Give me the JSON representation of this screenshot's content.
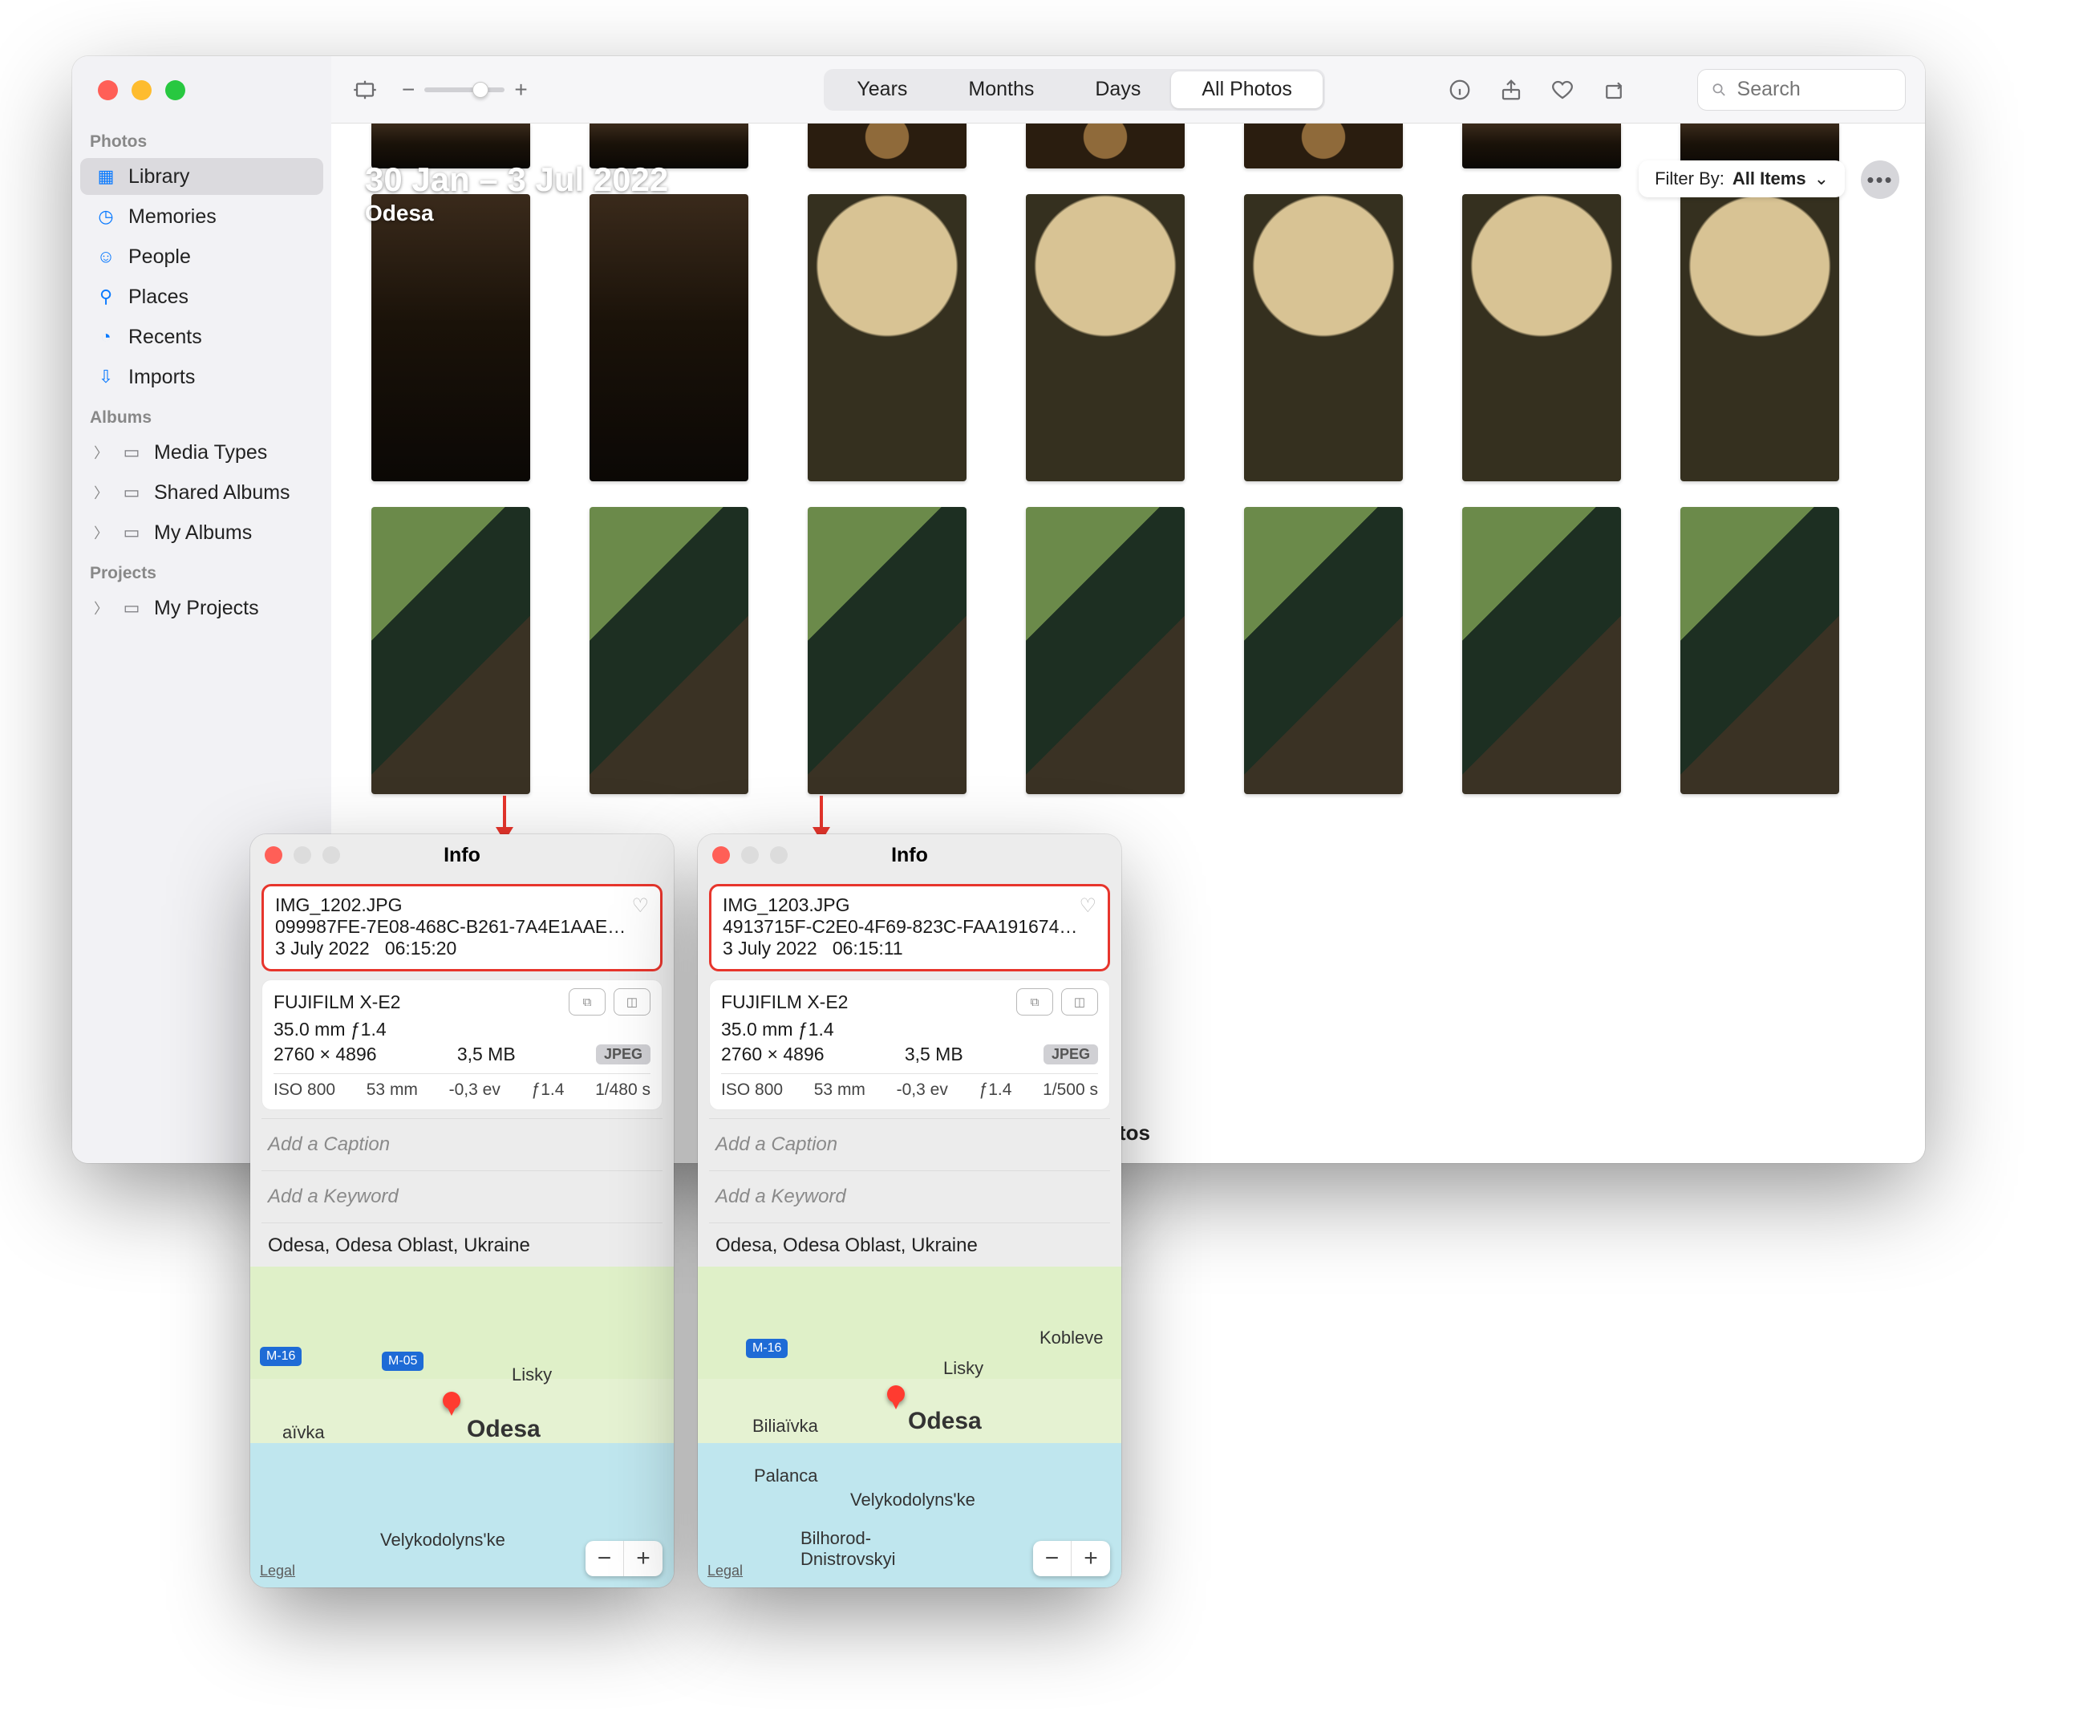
{
  "sidebar": {
    "sections": {
      "photos": "Photos",
      "albums": "Albums",
      "projects": "Projects"
    },
    "items": {
      "library": "Library",
      "memories": "Memories",
      "people": "People",
      "places": "Places",
      "recents": "Recents",
      "imports": "Imports",
      "mediaTypes": "Media Types",
      "sharedAlbums": "Shared Albums",
      "myAlbums": "My Albums",
      "myProjects": "My Projects"
    }
  },
  "toolbar": {
    "seg": {
      "years": "Years",
      "months": "Months",
      "days": "Days",
      "all": "All Photos"
    },
    "searchPlaceholder": "Search",
    "filterLabel": "Filter By:",
    "filterValue": "All Items"
  },
  "hero": {
    "title": "30 Jan – 3 Jul 2022",
    "subtitle": "Odesa"
  },
  "footer": {
    "label": "otos"
  },
  "infoWindow": {
    "title": "Info"
  },
  "panel1": {
    "filename": "IMG_1202.JPG",
    "uuid": "099987FE-7E08-468C-B261-7A4E1AAEFA...",
    "date": "3 July 2022",
    "time": "06:15:20",
    "camera": "FUJIFILM X-E2",
    "lens": "35.0 mm ƒ1.4",
    "dims": "2760 × 4896",
    "size": "3,5 MB",
    "format": "JPEG",
    "exif": {
      "iso": "ISO 800",
      "focal": "53 mm",
      "ev": "-0,3 ev",
      "ap": "ƒ1.4",
      "shutter": "1/480 s"
    },
    "caption": "Add a Caption",
    "keyword": "Add a Keyword",
    "location": "Odesa, Odesa Oblast, Ukraine",
    "legal": "Legal"
  },
  "panel2": {
    "filename": "IMG_1203.JPG",
    "uuid": "4913715F-C2E0-4F69-823C-FAA1916745B...",
    "date": "3 July 2022",
    "time": "06:15:11",
    "camera": "FUJIFILM X-E2",
    "lens": "35.0 mm ƒ1.4",
    "dims": "2760 × 4896",
    "size": "3,5 MB",
    "format": "JPEG",
    "exif": {
      "iso": "ISO 800",
      "focal": "53 mm",
      "ev": "-0,3 ev",
      "ap": "ƒ1.4",
      "shutter": "1/500 s"
    },
    "caption": "Add a Caption",
    "keyword": "Add a Keyword",
    "location": "Odesa, Odesa Oblast, Ukraine",
    "legal": "Legal"
  },
  "map": {
    "cities": {
      "odesa": "Odesa",
      "lisky": "Lisky",
      "biliaivka": "Biliaïvka",
      "velyko": "Velykodolyns'ke",
      "palanca": "Palanca",
      "kobleve": "Kobleve",
      "bilhorod": "Bilhorod-\nDnistrovskyi"
    },
    "road": "M-16",
    "road2": "M-05"
  }
}
